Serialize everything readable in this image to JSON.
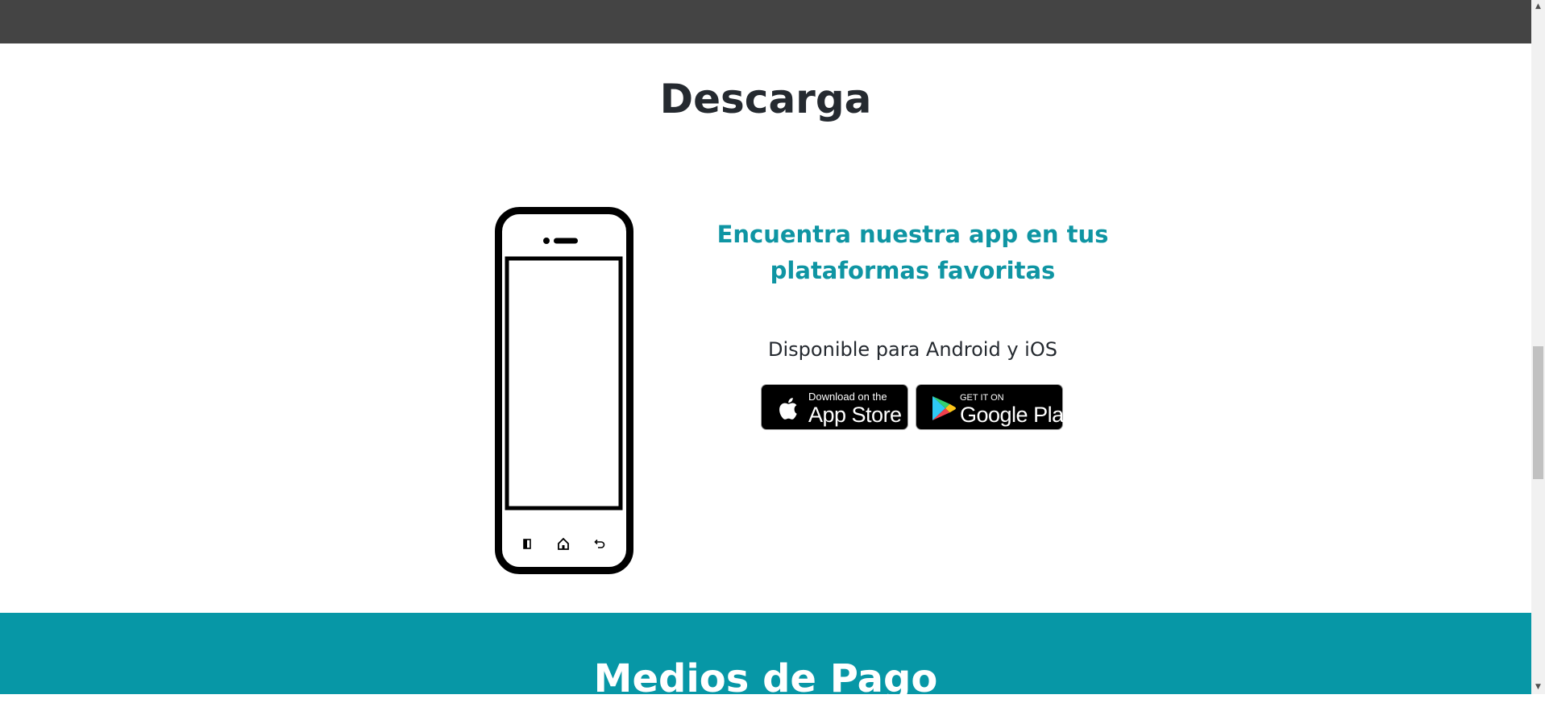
{
  "header": {
    "title": "Descarga"
  },
  "download": {
    "headline": "Encuentra nuestra app en tus plataformas favoritas",
    "availability": "Disponible para Android y iOS",
    "app_store": {
      "small_text": "Download on the",
      "big_text": "App Store",
      "icon": "apple-icon"
    },
    "google_play": {
      "small_text": "GET IT ON",
      "big_text": "Google Play",
      "icon": "google-play-icon"
    }
  },
  "payment_section": {
    "title": "Medios de Pago"
  },
  "colors": {
    "accent": "#0f95a3",
    "payment_band": "#0797a6",
    "top_bar": "#444444",
    "heading": "#252a30"
  }
}
